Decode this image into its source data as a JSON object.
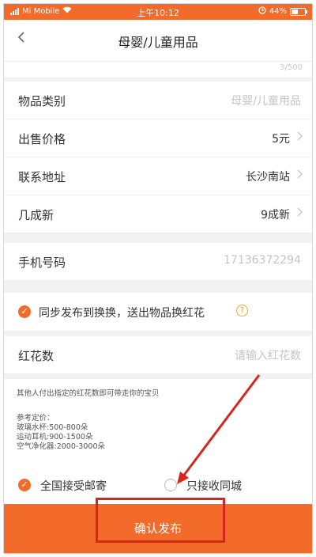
{
  "status_bar": {
    "carrier": "Mi Mobile",
    "time": "上午10:12",
    "battery": "44%"
  },
  "header": {
    "title": "母婴/儿童用品"
  },
  "description": {
    "counter": "3/500"
  },
  "fields": [
    {
      "label": "物品类别",
      "value": "母婴/儿童用品"
    },
    {
      "label": "出售价格",
      "value": "5元"
    },
    {
      "label": "联系地址",
      "value": "长沙南站"
    },
    {
      "label": "几成新",
      "value": "9成新"
    }
  ],
  "phone": {
    "label": "手机号码",
    "value": "17136372294"
  },
  "sync": {
    "label": "同步发布到换换，送出物品换红花",
    "checked": true
  },
  "flowers": {
    "label": "红花数",
    "placeholder": "请输入红花数"
  },
  "hint": {
    "text": "其他人付出指定的红花数即可带走你的宝贝",
    "ref_title": "参考定价：",
    "ref_items": [
      "玻璃水杯:500-800朵",
      "运动耳机:900-1500朵",
      "空气净化器:2000-3000朵"
    ]
  },
  "shipping": {
    "option_all": "全国接受邮寄",
    "option_local": "只接收同城",
    "all_checked": true
  },
  "confirm_button": {
    "label": "确认发布"
  },
  "colors": {
    "accent": "#f26b2a",
    "annotation": "#d9261c"
  }
}
